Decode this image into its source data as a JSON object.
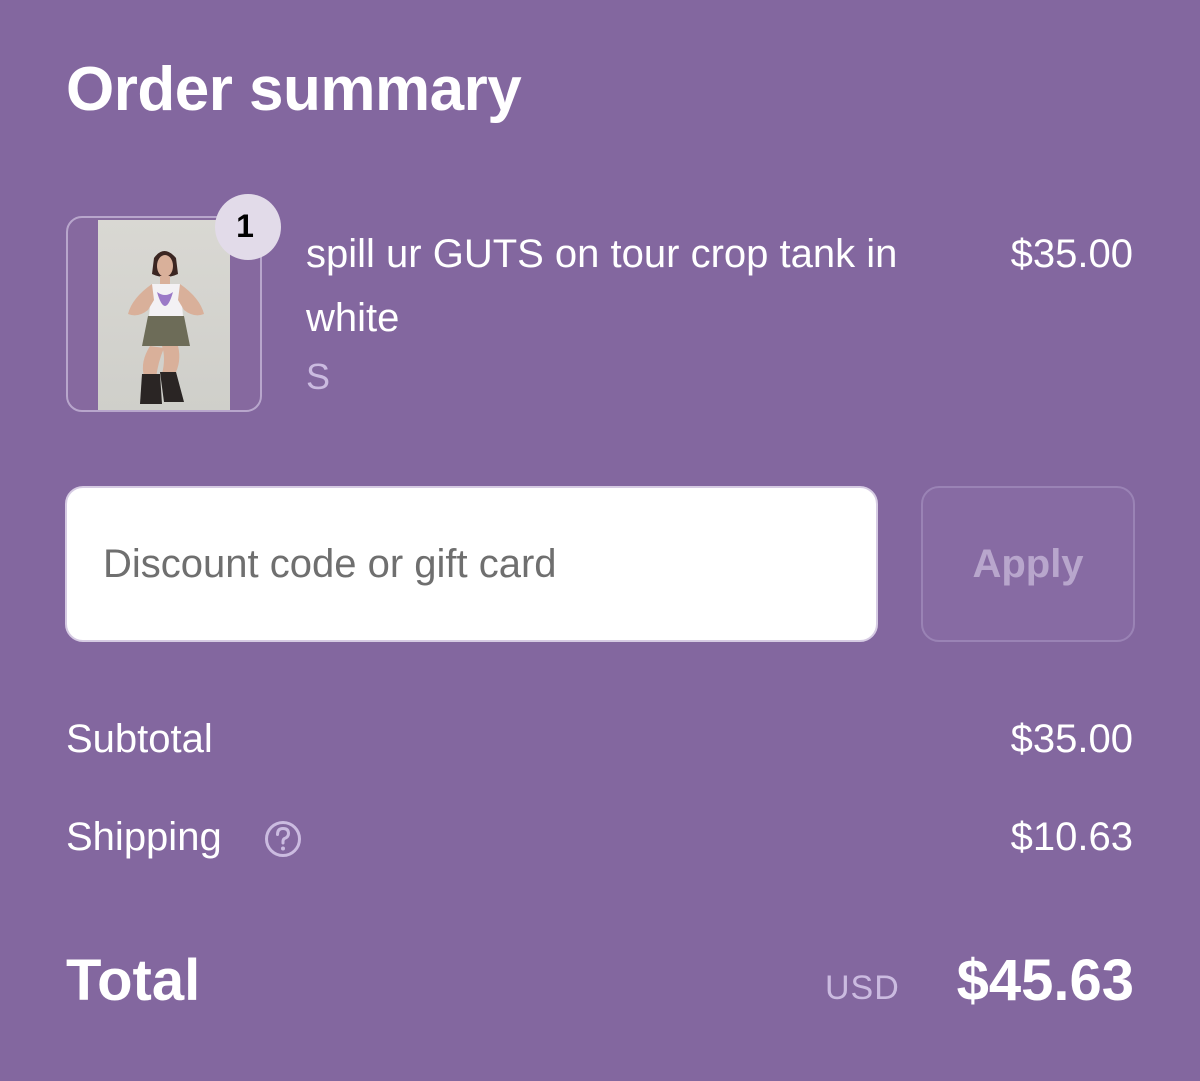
{
  "header": {
    "title": "Order summary"
  },
  "cart": {
    "items": [
      {
        "quantity": "1",
        "name": "spill ur GUTS on tour crop tank in white",
        "variant": "S",
        "price": "$35.00"
      }
    ]
  },
  "discount": {
    "placeholder": "Discount code or gift card",
    "apply_label": "Apply"
  },
  "totals": {
    "subtotal_label": "Subtotal",
    "subtotal_value": "$35.00",
    "shipping_label": "Shipping",
    "shipping_value": "$10.63",
    "total_label": "Total",
    "currency": "USD",
    "total_value": "$45.63"
  },
  "icons": {
    "shipping_help": "question-circle-icon",
    "product_image": "product-photo"
  },
  "colors": {
    "background": "#83679f",
    "muted_text": "#cbbbe0",
    "input_background": "#ffffff",
    "badge_background": "#e2dbe9"
  }
}
